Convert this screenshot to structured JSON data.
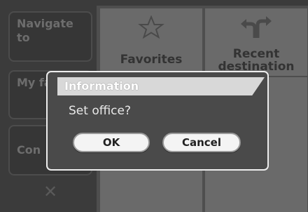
{
  "left_menu": {
    "navigate_label": "Navigate to",
    "favorites_label": "My fav",
    "contacts_label": "Con",
    "close_glyph": "✕"
  },
  "tiles": {
    "favorites": {
      "label": "Favorites",
      "icon": "star-icon"
    },
    "recent": {
      "label": "Recent destination",
      "icon": "turn-arrows-icon"
    }
  },
  "dialog": {
    "title": "Information",
    "message": "Set office?",
    "ok_label": "OK",
    "cancel_label": "Cancel"
  },
  "colors": {
    "background": "#3b3b3b",
    "dialog_bg": "#4a4a4a",
    "dialog_border": "#ededed",
    "button_bg": "#f4f4f4"
  }
}
